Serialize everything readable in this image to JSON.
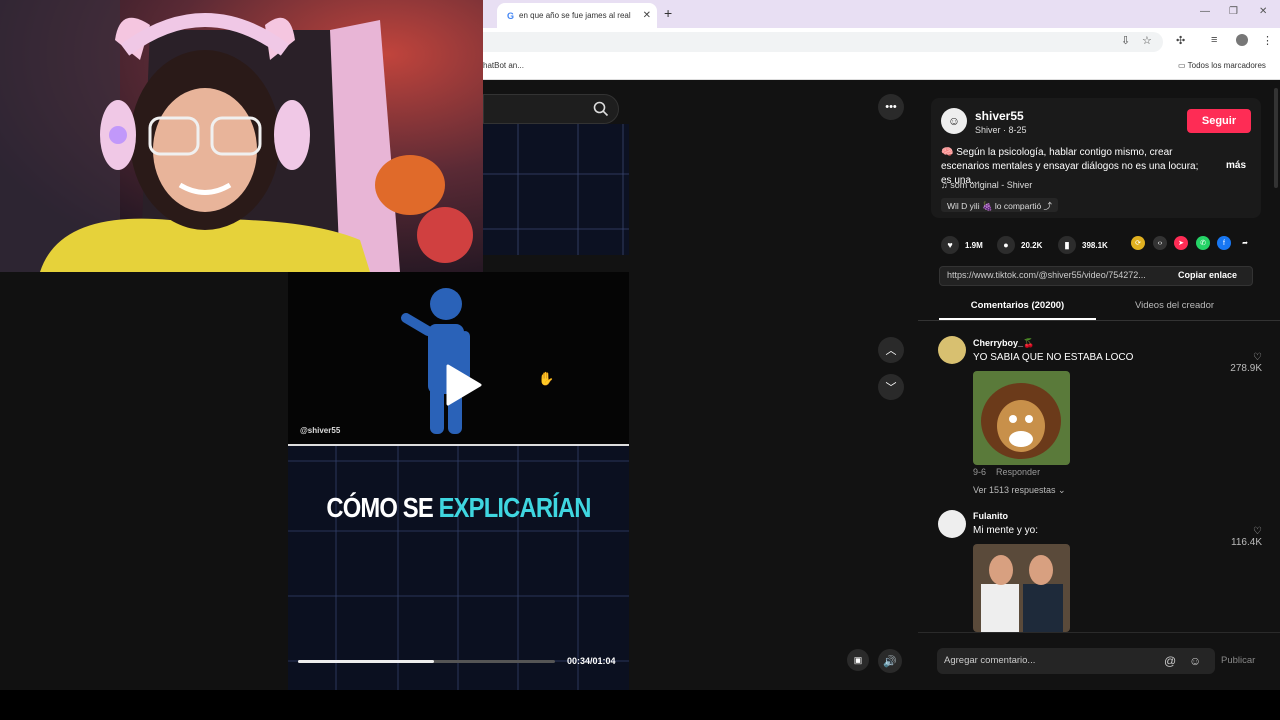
{
  "browser": {
    "tab_title": "en que año se fue james al real",
    "tab_favicon": "G",
    "tab_close": "✕",
    "new_tab": "+",
    "window_controls": [
      "—",
      "❐",
      "✕"
    ],
    "bookmark_left": "hatBot an...",
    "bookmark_right": "Todos los marcadores"
  },
  "video": {
    "handle": "@shiver55",
    "caption_white": "CÓMO SE ",
    "caption_cyan": "EXPLICARÍAN",
    "time": "00:34/01:04",
    "progress": 0.53
  },
  "post": {
    "author": "shiver55",
    "author_sub": "Shiver · 8-25",
    "follow_label": "Seguir",
    "description": "🧠 Según la psicología, hablar contigo mismo, crear escenarios mentales y ensayar diálogos no es una locura; es una...",
    "more_label": "más",
    "music": "♫  som original - Shiver",
    "shared": "Wil D yili 🍇 lo compartió  ⤴",
    "likes": "1.9M",
    "comments": "20.2K",
    "saves": "398.1K",
    "link": "https://www.tiktok.com/@shiver55/video/754272...",
    "copy_label": "Copiar enlace"
  },
  "tabs": {
    "comments": "Comentarios (20200)",
    "creator": "Videos del creador"
  },
  "comment_list": [
    {
      "name": "Cherryboy_🍒",
      "text": "YO SABIA QUE NO ESTABA LOCO",
      "likes": "278.9K",
      "date": "9-6",
      "reply": "Responder",
      "replies": "Ver 1513 respuestas ⌄"
    },
    {
      "name": "Fulanito",
      "text": "Mi mente y yo:",
      "likes": "116.4K"
    }
  ],
  "composer": {
    "placeholder": "Agregar comentario...",
    "publish": "Publicar"
  },
  "colors": {
    "accent": "#fe2c55",
    "caption_cyan": "#3fd6e0",
    "figure_blue": "#2a62b8"
  },
  "icons": [
    "search-icon",
    "play-icon",
    "ellipsis-icon",
    "chevron-up-icon",
    "chevron-down-icon",
    "volume-icon",
    "heart-icon",
    "comment-icon",
    "bookmark-icon",
    "share-icon"
  ]
}
